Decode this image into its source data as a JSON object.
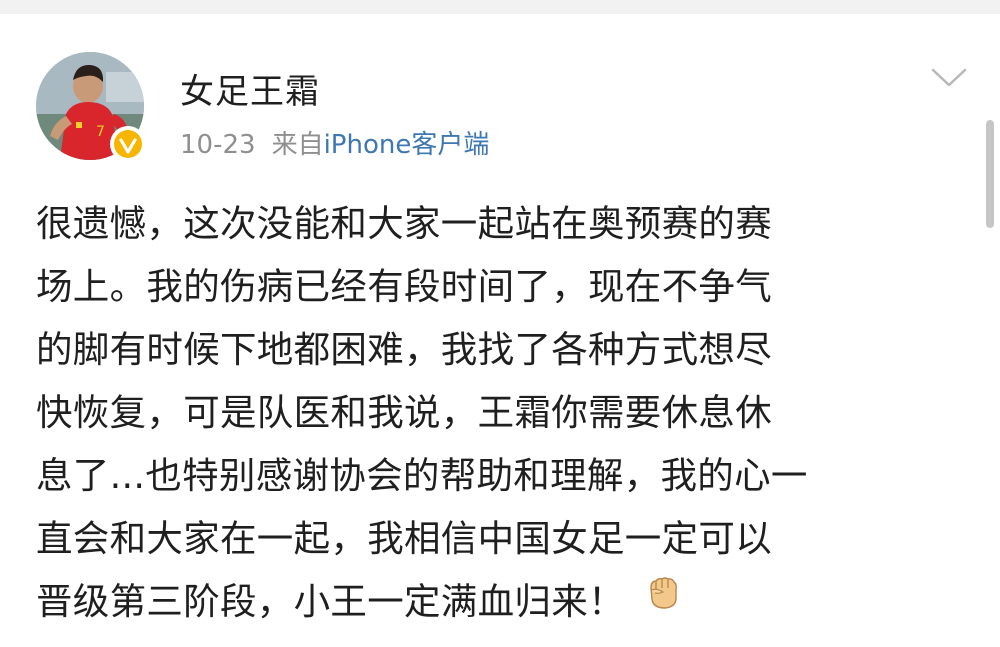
{
  "post": {
    "username": "女足王霜",
    "date": "10-23",
    "source_prefix": "来自",
    "source_app": "iPhone客户端",
    "text_lines": [
      "很遗憾，这次没能和大家一起站在奥预赛的赛",
      "场上。我的伤病已经有段时间了，现在不争气",
      "的脚有时候下地都困难，我找了各种方式想尽",
      "快恢复，可是队医和我说，王霜你需要休息休",
      "息了...也特别感谢协会的帮助和理解，我的心一",
      "直会和大家在一起，我相信中国女足一定可以",
      "晋级第三阶段，小王一定满血归来！"
    ],
    "emoji": "fist-emoji"
  },
  "icons": {
    "avatar": "player-avatar",
    "verified": "verified-v-badge-icon",
    "menu": "chevron-down-icon"
  },
  "colors": {
    "text": "#1f1f1f",
    "meta": "#8f8f8f",
    "link": "#3f78b0",
    "badge": "#f7b500"
  }
}
